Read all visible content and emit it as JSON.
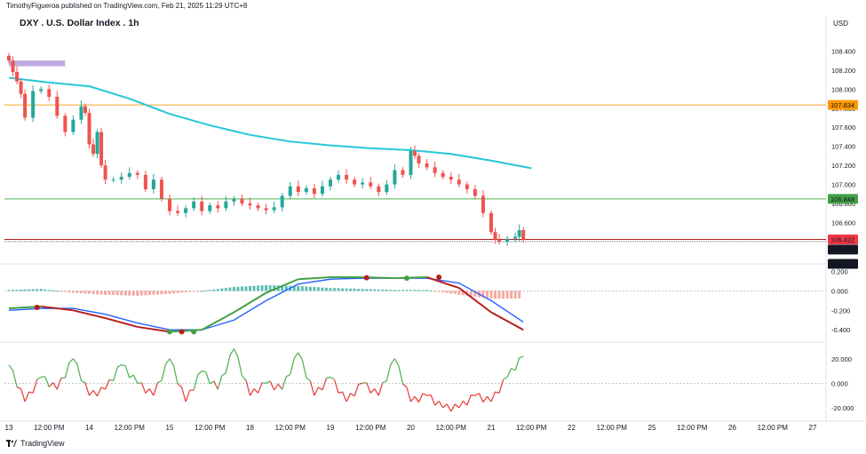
{
  "header": {
    "published": "TimothyFigueroa published on TradingView.com, Feb 21, 2025 11:29 UTC+8",
    "title": "DXY . U.S. Dollar Index . 1h",
    "currency": "USD"
  },
  "footer": {
    "brand": "TradingView"
  },
  "colors": {
    "up": "#26a69a",
    "down": "#ef5350",
    "ema": "#26c6da",
    "orange": "#f5a623",
    "green_line": "#4caf50",
    "badge_orange": "#ff9800",
    "badge_green": "#43a047",
    "badge_red": "#f23645",
    "macd_fast": "#43a047",
    "macd_fast_down": "#b71c1c",
    "macd_slow": "#2962ff",
    "osc": "#4caf50",
    "osc_down": "#e53935"
  },
  "chart_data": [
    {
      "type": "candlestick",
      "name": "price",
      "y_axis_ticks": [
        "108.400",
        "108.200",
        "108.000",
        "107.800",
        "107.600",
        "107.400",
        "107.200",
        "107.000",
        "106.800",
        "106.600",
        "106.400"
      ],
      "ylim": [
        106.25,
        108.6
      ],
      "x_range_days": [
        13,
        27
      ],
      "x_axis_labels": [
        {
          "day": 13.0,
          "label": "13"
        },
        {
          "day": 13.5,
          "label": "12:00 PM"
        },
        {
          "day": 14.0,
          "label": "14"
        },
        {
          "day": 14.5,
          "label": "12:00 PM"
        },
        {
          "day": 15.0,
          "label": "15"
        },
        {
          "day": 15.5,
          "label": "12:00 PM"
        },
        {
          "day": 16.0,
          "label": "18"
        },
        {
          "day": 16.5,
          "label": "12:00 PM"
        },
        {
          "day": 17.0,
          "label": "19"
        },
        {
          "day": 17.5,
          "label": "12:00 PM"
        },
        {
          "day": 18.0,
          "label": "20"
        },
        {
          "day": 18.5,
          "label": "12:00 PM"
        },
        {
          "day": 19.0,
          "label": "21"
        },
        {
          "day": 19.5,
          "label": "12:00 PM"
        },
        {
          "day": 20.0,
          "label": "22"
        },
        {
          "day": 20.5,
          "label": "12:00 PM"
        },
        {
          "day": 21.0,
          "label": "25"
        },
        {
          "day": 21.5,
          "label": "12:00 PM"
        },
        {
          "day": 22.0,
          "label": "26"
        },
        {
          "day": 22.5,
          "label": "12:00 PM"
        },
        {
          "day": 23.0,
          "label": "27"
        }
      ],
      "horizontal_levels": [
        {
          "value": 107.834,
          "label": "107.834",
          "color": "#f5a623",
          "badge": "#ff9800"
        },
        {
          "value": 106.848,
          "label": "106.848",
          "color": "#4caf50",
          "badge": "#43a047"
        },
        {
          "value": 106.422,
          "label": "106.422",
          "color": "#b71c1c",
          "badge": "#f23645"
        }
      ],
      "extra_badges": [
        {
          "value": 106.4,
          "label": "106.400",
          "bg": "#131722"
        },
        {
          "value": 106.111,
          "label": "106.111",
          "bg": "#131722"
        }
      ],
      "close_path": [
        [
          13.0,
          108.3
        ],
        [
          13.05,
          108.18
        ],
        [
          13.1,
          108.08
        ],
        [
          13.15,
          107.95
        ],
        [
          13.2,
          107.7
        ],
        [
          13.3,
          107.98
        ],
        [
          13.4,
          108.0
        ],
        [
          13.5,
          107.92
        ],
        [
          13.6,
          107.72
        ],
        [
          13.7,
          107.55
        ],
        [
          13.8,
          107.68
        ],
        [
          13.9,
          107.82
        ],
        [
          13.95,
          107.75
        ],
        [
          14.0,
          107.42
        ],
        [
          14.05,
          107.32
        ],
        [
          14.1,
          107.55
        ],
        [
          14.15,
          107.2
        ],
        [
          14.2,
          107.05
        ],
        [
          14.3,
          107.05
        ],
        [
          14.4,
          107.08
        ],
        [
          14.5,
          107.12
        ],
        [
          14.6,
          107.1
        ],
        [
          14.7,
          106.95
        ],
        [
          14.8,
          107.05
        ],
        [
          14.9,
          106.85
        ],
        [
          15.0,
          106.72
        ],
        [
          15.1,
          106.7
        ],
        [
          15.2,
          106.75
        ],
        [
          15.3,
          106.82
        ],
        [
          15.4,
          106.72
        ],
        [
          15.5,
          106.78
        ],
        [
          15.6,
          106.75
        ],
        [
          15.7,
          106.82
        ],
        [
          15.8,
          106.85
        ],
        [
          15.9,
          106.8
        ],
        [
          16.0,
          106.78
        ],
        [
          16.1,
          106.75
        ],
        [
          16.2,
          106.73
        ],
        [
          16.3,
          106.76
        ],
        [
          16.4,
          106.88
        ],
        [
          16.5,
          106.98
        ],
        [
          16.6,
          106.92
        ],
        [
          16.7,
          106.96
        ],
        [
          16.8,
          106.9
        ],
        [
          16.9,
          106.98
        ],
        [
          17.0,
          107.05
        ],
        [
          17.1,
          107.1
        ],
        [
          17.2,
          107.05
        ],
        [
          17.3,
          107.0
        ],
        [
          17.4,
          107.02
        ],
        [
          17.5,
          106.98
        ],
        [
          17.6,
          106.92
        ],
        [
          17.7,
          107.0
        ],
        [
          17.8,
          107.15
        ],
        [
          17.9,
          107.1
        ],
        [
          18.0,
          107.35
        ],
        [
          18.05,
          107.3
        ],
        [
          18.1,
          107.22
        ],
        [
          18.2,
          107.18
        ],
        [
          18.3,
          107.12
        ],
        [
          18.4,
          107.08
        ],
        [
          18.5,
          107.05
        ],
        [
          18.6,
          107.0
        ],
        [
          18.7,
          106.95
        ],
        [
          18.8,
          106.88
        ],
        [
          18.9,
          106.7
        ],
        [
          19.0,
          106.5
        ],
        [
          19.05,
          106.42
        ],
        [
          19.1,
          106.4
        ],
        [
          19.2,
          106.43
        ],
        [
          19.3,
          106.45
        ],
        [
          19.35,
          106.52
        ],
        [
          19.4,
          106.42
        ]
      ],
      "ema_path": [
        [
          13.0,
          108.12
        ],
        [
          13.5,
          108.07
        ],
        [
          14.0,
          108.03
        ],
        [
          14.5,
          107.9
        ],
        [
          15.0,
          107.74
        ],
        [
          15.5,
          107.62
        ],
        [
          16.0,
          107.52
        ],
        [
          16.5,
          107.45
        ],
        [
          17.0,
          107.41
        ],
        [
          17.5,
          107.38
        ],
        [
          18.0,
          107.36
        ],
        [
          18.5,
          107.32
        ],
        [
          19.0,
          107.25
        ],
        [
          19.5,
          107.17
        ]
      ],
      "zone": {
        "from_day": 13.0,
        "to_day": 13.7,
        "high": 108.3,
        "low": 108.24,
        "color": "#b39ddb"
      }
    },
    {
      "type": "line",
      "name": "macd",
      "y_axis_ticks": [
        "0.200",
        "0.000",
        "-0.200",
        "-0.400"
      ],
      "ylim": [
        -0.48,
        0.25
      ],
      "x": [
        13.0,
        13.4,
        13.8,
        14.2,
        14.6,
        15.0,
        15.4,
        15.8,
        16.2,
        16.6,
        17.0,
        17.4,
        17.8,
        18.2,
        18.6,
        19.0,
        19.4
      ],
      "series": [
        {
          "values": [
            -0.18,
            -0.16,
            -0.2,
            -0.28,
            -0.37,
            -0.42,
            -0.4,
            -0.22,
            -0.02,
            0.12,
            0.14,
            0.14,
            0.13,
            0.14,
            0.03,
            -0.22,
            -0.4
          ]
        },
        {
          "values": [
            -0.2,
            -0.18,
            -0.18,
            -0.24,
            -0.33,
            -0.4,
            -0.4,
            -0.3,
            -0.1,
            0.07,
            0.12,
            0.13,
            0.13,
            0.13,
            0.08,
            -0.1,
            -0.32
          ]
        }
      ],
      "histogram": [
        0.01,
        0.02,
        -0.02,
        -0.04,
        -0.05,
        -0.03,
        0.0,
        0.04,
        0.06,
        0.05,
        0.03,
        0.02,
        0.01,
        0.01,
        -0.04,
        -0.08,
        -0.08
      ],
      "signal_dots": [
        {
          "x": 13.35,
          "y": -0.17,
          "color": "#b71c1c"
        },
        {
          "x": 15.0,
          "y": -0.42,
          "color": "#43a047"
        },
        {
          "x": 15.15,
          "y": -0.42,
          "color": "#b71c1c"
        },
        {
          "x": 15.3,
          "y": -0.42,
          "color": "#43a047"
        },
        {
          "x": 17.45,
          "y": 0.135,
          "color": "#b71c1c"
        },
        {
          "x": 17.95,
          "y": 0.13,
          "color": "#43a047"
        },
        {
          "x": 18.35,
          "y": 0.14,
          "color": "#b71c1c"
        }
      ]
    },
    {
      "type": "line",
      "name": "oscillator",
      "y_axis_ticks": [
        "20.000",
        "0.000",
        "-20.000"
      ],
      "ylim": [
        -28,
        30
      ],
      "x": [
        13.0,
        13.2,
        13.4,
        13.6,
        13.8,
        14.0,
        14.2,
        14.4,
        14.6,
        14.8,
        15.0,
        15.2,
        15.4,
        15.6,
        15.8,
        16.0,
        16.2,
        16.4,
        16.6,
        16.8,
        17.0,
        17.2,
        17.4,
        17.6,
        17.8,
        18.0,
        18.2,
        18.4,
        18.6,
        18.8,
        19.0,
        19.2,
        19.4
      ],
      "series": [
        {
          "values": [
            15,
            -15,
            5,
            -5,
            20,
            -10,
            -5,
            15,
            0,
            -10,
            20,
            -15,
            10,
            -5,
            28,
            -10,
            0,
            -5,
            25,
            -10,
            5,
            -15,
            0,
            -10,
            20,
            -15,
            -10,
            -20,
            -20,
            -10,
            -15,
            5,
            22
          ]
        }
      ]
    }
  ]
}
